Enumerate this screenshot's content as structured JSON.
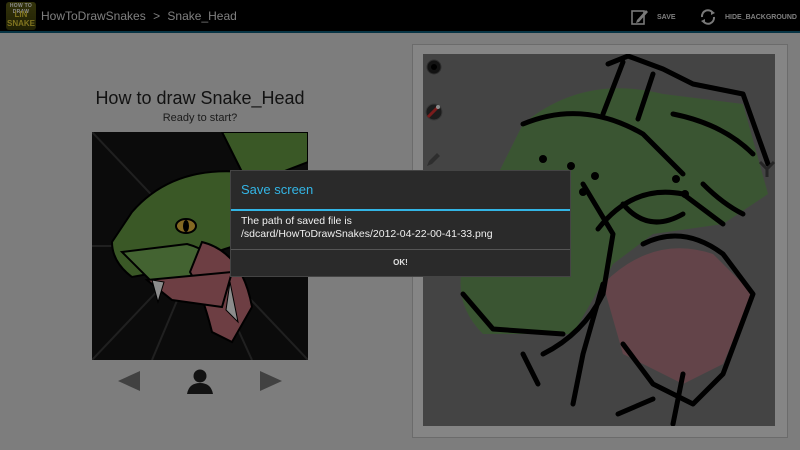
{
  "actionbar": {
    "logo": {
      "line1": "HOW TO DRAW",
      "line2": "LIN",
      "line3": "SNAKE"
    },
    "breadcrumb": [
      "HowToDrawSnakes",
      ">",
      "Snake_Head"
    ],
    "save_label": "SAVE",
    "hide_bg_label": "HIDE_BACKGROUND"
  },
  "lesson": {
    "title": "How to draw Snake_Head",
    "subtitle": "Ready to start?"
  },
  "dialog": {
    "title": "Save screen",
    "message_line1": "The path of saved file is",
    "message_line2": "/sdcard/HowToDrawSnakes/2012-04-22-00-41-33.png",
    "ok_label": "OK!"
  },
  "colors": {
    "accent": "#33b5e5",
    "actionbar": "#000000",
    "dialog_bg": "#2a2a2a",
    "snake_green": "#6aa046"
  },
  "icons": [
    "save-icon",
    "refresh-icon",
    "prev-arrow-icon",
    "user-icon",
    "next-arrow-icon",
    "brush-icon",
    "color-picker-icon",
    "pencil-icon"
  ]
}
